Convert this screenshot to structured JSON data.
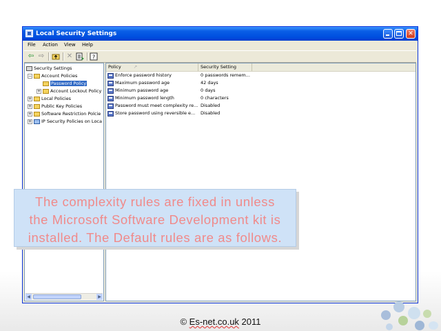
{
  "window": {
    "title": "Local Security Settings",
    "menu": [
      "File",
      "Action",
      "View",
      "Help"
    ]
  },
  "toolbar": {
    "icons": [
      "back-icon",
      "forward-icon",
      "up-folder-icon",
      "delete-icon",
      "export-list-icon",
      "help-icon"
    ]
  },
  "tree": {
    "items": [
      {
        "label": "Security Settings",
        "level": 0
      },
      {
        "label": "Account Policies",
        "level": 1,
        "expanded": true
      },
      {
        "label": "Password Policy",
        "level": 2,
        "selected": true
      },
      {
        "label": "Account Lockout Policy",
        "level": 2
      },
      {
        "label": "Local Policies",
        "level": 1
      },
      {
        "label": "Public Key Policies",
        "level": 1
      },
      {
        "label": "Software Restriction Polcie",
        "level": 1
      },
      {
        "label": "IP Security Policies on Loca",
        "level": 1
      }
    ]
  },
  "list": {
    "columns": [
      "Policy",
      "Security Setting"
    ],
    "rows": [
      {
        "policy": "Enforce password history",
        "setting": "0 passwords remem..."
      },
      {
        "policy": "Maximum password age",
        "setting": "42 days"
      },
      {
        "policy": "Minimum password age",
        "setting": "0 days"
      },
      {
        "policy": "Minimum password length",
        "setting": "0 characters"
      },
      {
        "policy": "Password must meet complexity re...",
        "setting": "Disabled"
      },
      {
        "policy": "Store password using reversible e...",
        "setting": "Disabled"
      }
    ]
  },
  "callout": {
    "line1": "The complexity rules are fixed in unless",
    "line2": "the Microsoft Software Development kit is",
    "line3": "installed. The Default rules are as follows."
  },
  "footer": {
    "prefix": "© ",
    "domain": "Es-net.co.uk",
    "year": " 2011"
  },
  "colors": {
    "title_bar": "#0a5fe6",
    "selection": "#316ac5",
    "callout_bg": "#cfe2f7",
    "callout_text": "#f08a8a"
  }
}
